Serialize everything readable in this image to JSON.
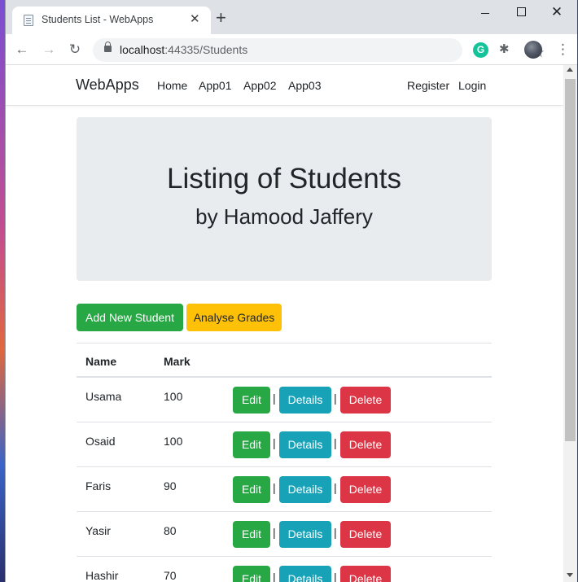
{
  "browser": {
    "tab_title": "Students List - WebApps",
    "tab_close": "✕",
    "new_tab": "+",
    "url_host": "localhost",
    "url_rest": ":44335/Students",
    "grammarly_letter": "G",
    "back_glyph": "←",
    "forward_glyph": "→",
    "reload_glyph": "↻",
    "star_glyph": "☆",
    "menu_glyph": "⋮",
    "ext_glyph": "✱",
    "close_glyph": "✕"
  },
  "navbar": {
    "brand": "WebApps",
    "links": [
      "Home",
      "App01",
      "App02",
      "App03"
    ],
    "right_links": [
      "Register",
      "Login"
    ]
  },
  "jumbotron": {
    "title": "Listing of Students",
    "subtitle": "by Hamood Jaffery"
  },
  "buttons": {
    "add": "Add New Student",
    "analyse": "Analyse Grades"
  },
  "table": {
    "headers": [
      "Name",
      "Mark"
    ],
    "separator": "|",
    "actions": [
      "Edit",
      "Details",
      "Delete"
    ],
    "rows": [
      {
        "name": "Usama",
        "mark": "100"
      },
      {
        "name": "Osaid",
        "mark": "100"
      },
      {
        "name": "Faris",
        "mark": "90"
      },
      {
        "name": "Yasir",
        "mark": "80"
      },
      {
        "name": "Hashir",
        "mark": "70"
      }
    ]
  },
  "colors": {
    "success": "#28a745",
    "info": "#17a2b8",
    "danger": "#dc3545",
    "warning": "#ffc107"
  }
}
